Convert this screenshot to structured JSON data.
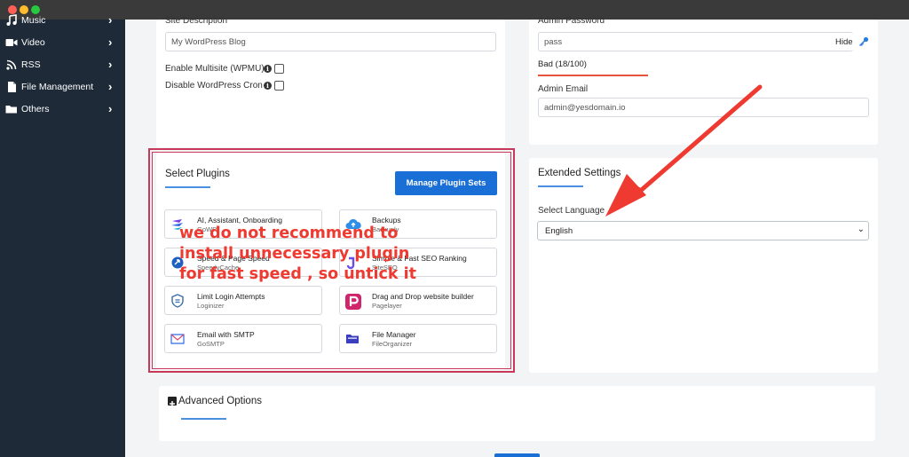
{
  "window": {
    "controls": [
      "close",
      "minimize",
      "maximize"
    ]
  },
  "sidebar": {
    "items": [
      {
        "label": "Music",
        "icon": "music-icon"
      },
      {
        "label": "Video",
        "icon": "video-icon"
      },
      {
        "label": "RSS",
        "icon": "rss-icon"
      },
      {
        "label": "File Management",
        "icon": "file-icon"
      },
      {
        "label": "Others",
        "icon": "folder-icon"
      }
    ]
  },
  "site": {
    "description_label": "Site Description",
    "description_value": "My WordPress Blog",
    "multisite_label": "Enable Multisite (WPMU)",
    "cron_label": "Disable WordPress Cron"
  },
  "admin": {
    "password_label": "Admin Password",
    "password_value": "pass",
    "hide_label": "Hide",
    "strength_text": "Bad (18/100)",
    "strength_color": "#e5533d",
    "email_label": "Admin Email",
    "email_value": "admin@yesdomain.io"
  },
  "plugins": {
    "heading": "Select Plugins",
    "manage_button": "Manage Plugin Sets",
    "items": [
      {
        "name": "AI, Assistant, Onboarding",
        "sub": "GoWP",
        "icon": "stack-icon"
      },
      {
        "name": "Backups",
        "sub": "Backuply",
        "icon": "cloud-upload-icon"
      },
      {
        "name": "Speed & Page Speed",
        "sub": "SpeedyCache",
        "icon": "rocket-icon"
      },
      {
        "name": "Simple & Fast SEO Ranking",
        "sub": "SiteSEO",
        "icon": "seo-icon"
      },
      {
        "name": "Limit Login Attempts",
        "sub": "Loginizer",
        "icon": "shield-icon"
      },
      {
        "name": "Drag and Drop website builder",
        "sub": "Pagelayer",
        "icon": "pagelayer-icon"
      },
      {
        "name": "Email with SMTP",
        "sub": "GoSMTP",
        "icon": "mail-icon"
      },
      {
        "name": "File Manager",
        "sub": "FileOrganizer",
        "icon": "folder-icon"
      }
    ]
  },
  "extended": {
    "heading": "Extended Settings",
    "language_label": "Select Language",
    "language_value": "English"
  },
  "advanced": {
    "heading": "Advanced Options"
  },
  "annotation": {
    "lines": [
      "we do not recommend to",
      "install unnecessary plugin",
      "for fast speed , so untick it"
    ],
    "color": "#ee3a30"
  },
  "colors": {
    "sidebar_bg": "#1e2a38",
    "accent": "#1a6fd6",
    "highlight_border": "#c8385a"
  }
}
